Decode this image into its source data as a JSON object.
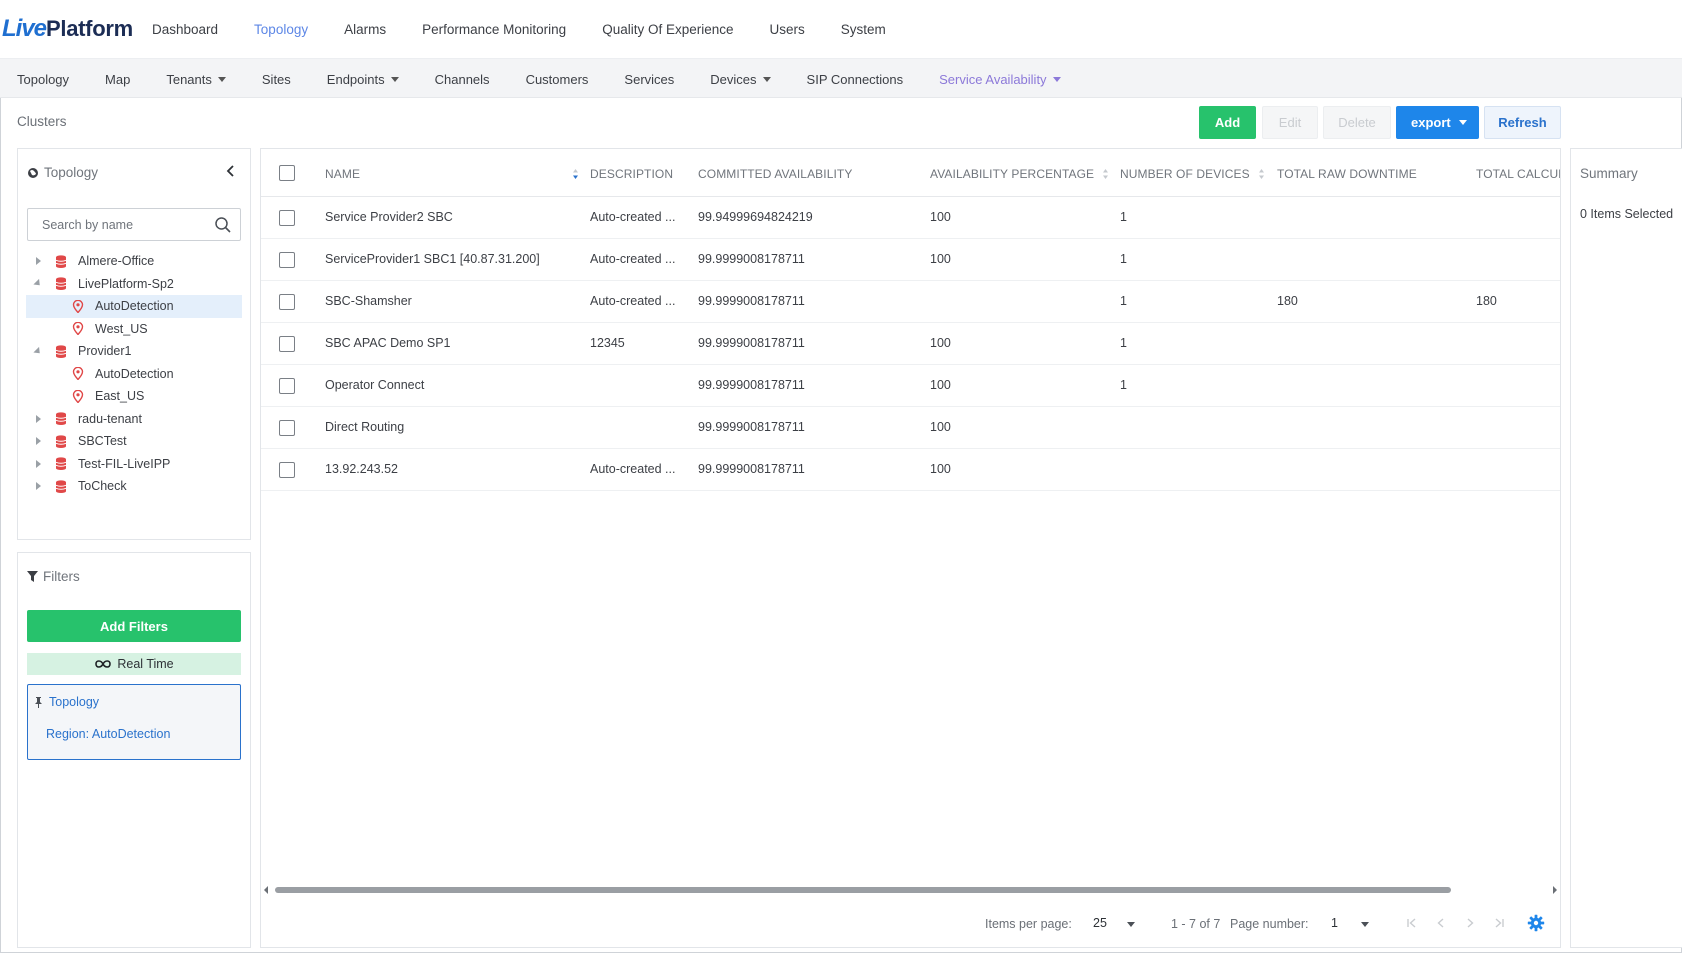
{
  "app": {
    "logo_live": "Live",
    "logo_platform": "Platform"
  },
  "topnav": {
    "items": [
      {
        "label": "Dashboard",
        "active": false
      },
      {
        "label": "Topology",
        "active": true
      },
      {
        "label": "Alarms",
        "active": false
      },
      {
        "label": "Performance Monitoring",
        "active": false
      },
      {
        "label": "Quality Of Experience",
        "active": false
      },
      {
        "label": "Users",
        "active": false
      },
      {
        "label": "System",
        "active": false
      }
    ]
  },
  "subnav": {
    "items": [
      {
        "label": "Topology",
        "dropdown": false
      },
      {
        "label": "Map",
        "dropdown": false
      },
      {
        "label": "Tenants",
        "dropdown": true
      },
      {
        "label": "Sites",
        "dropdown": false
      },
      {
        "label": "Endpoints",
        "dropdown": true
      },
      {
        "label": "Channels",
        "dropdown": false
      },
      {
        "label": "Customers",
        "dropdown": false
      },
      {
        "label": "Services",
        "dropdown": false
      },
      {
        "label": "Devices",
        "dropdown": true
      },
      {
        "label": "SIP Connections",
        "dropdown": false
      },
      {
        "label": "Service Availability",
        "dropdown": true,
        "active": true
      }
    ]
  },
  "page": {
    "title": "Clusters"
  },
  "toolbar": {
    "add_label": "Add",
    "edit_label": "Edit",
    "delete_label": "Delete",
    "export_label": "export",
    "refresh_label": "Refresh"
  },
  "topology_panel": {
    "title": "Topology",
    "search_placeholder": "Search by name",
    "tree": [
      {
        "label": "Almere-Office",
        "type": "tenant",
        "expanded": false
      },
      {
        "label": "LivePlatform-Sp2",
        "type": "tenant",
        "expanded": true
      },
      {
        "label": "AutoDetection",
        "type": "region",
        "selected": true
      },
      {
        "label": "West_US",
        "type": "region"
      },
      {
        "label": "Provider1",
        "type": "tenant",
        "expanded": true
      },
      {
        "label": "AutoDetection",
        "type": "region"
      },
      {
        "label": "East_US",
        "type": "region"
      },
      {
        "label": "radu-tenant",
        "type": "tenant",
        "expanded": false
      },
      {
        "label": "SBCTest",
        "type": "tenant",
        "expanded": false
      },
      {
        "label": "Test-FIL-LiveIPP",
        "type": "tenant",
        "expanded": false
      },
      {
        "label": "ToCheck",
        "type": "tenant",
        "expanded": false
      }
    ]
  },
  "filters_panel": {
    "title": "Filters",
    "add_filters_label": "Add Filters",
    "realtime_label": "Real Time",
    "topology_filter_title": "Topology",
    "topology_filter_region": "Region: AutoDetection"
  },
  "grid": {
    "columns": [
      "NAME",
      "DESCRIPTION",
      "COMMITTED AVAILABILITY",
      "AVAILABILITY PERCENTAGE",
      "NUMBER OF DEVICES",
      "TOTAL RAW DOWNTIME",
      "TOTAL CALCUL"
    ],
    "rows": [
      {
        "name": "Service Provider2 SBC",
        "description": "Auto-created ...",
        "committed": "99.94999694824219",
        "availability": "100",
        "devices": "1",
        "raw_downtime": "",
        "calc_downtime": ""
      },
      {
        "name": "ServiceProvider1 SBC1 [40.87.31.200]",
        "description": "Auto-created ...",
        "committed": "99.9999008178711",
        "availability": "100",
        "devices": "1",
        "raw_downtime": "",
        "calc_downtime": ""
      },
      {
        "name": "SBC-Shamsher",
        "description": "Auto-created ...",
        "committed": "99.9999008178711",
        "availability": "",
        "devices": "1",
        "raw_downtime": "180",
        "calc_downtime": "180"
      },
      {
        "name": "SBC APAC Demo SP1",
        "description": "12345",
        "committed": "99.9999008178711",
        "availability": "100",
        "devices": "1",
        "raw_downtime": "",
        "calc_downtime": ""
      },
      {
        "name": "Operator Connect",
        "description": "",
        "committed": "99.9999008178711",
        "availability": "100",
        "devices": "1",
        "raw_downtime": "",
        "calc_downtime": ""
      },
      {
        "name": "Direct Routing",
        "description": "",
        "committed": "99.9999008178711",
        "availability": "100",
        "devices": "",
        "raw_downtime": "",
        "calc_downtime": ""
      },
      {
        "name": "13.92.243.52",
        "description": "Auto-created ...",
        "committed": "99.9999008178711",
        "availability": "100",
        "devices": "",
        "raw_downtime": "",
        "calc_downtime": ""
      }
    ]
  },
  "pager": {
    "items_per_page_label": "Items per page:",
    "items_per_page": "25",
    "range_label": "1 - 7 of 7",
    "page_number_label": "Page number:",
    "page_number": "1"
  },
  "summary_panel": {
    "title": "Summary",
    "selected_label": "0 Items Selected"
  },
  "colors": {
    "primary_green": "#27c26c",
    "primary_blue": "#1e86ea",
    "link_blue": "#2a72cc",
    "active_nav": "#5d87e6",
    "tenant_icon": "#e04848"
  }
}
